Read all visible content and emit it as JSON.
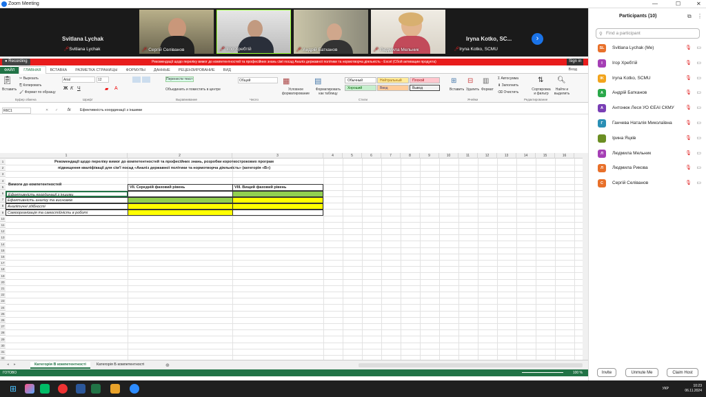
{
  "window": {
    "title": "Zoom Meeting"
  },
  "gallery": {
    "tiles": [
      {
        "name": "Svitlana Lychak"
      },
      {
        "name": "Сергій Селіванов"
      },
      {
        "name": "Ігор Хребтій"
      },
      {
        "name": "Андрій Батканов"
      },
      {
        "name": "Людмила Мельник"
      },
      {
        "name": "Iryna Kotko, SCMU"
      }
    ],
    "big_names": [
      "Svitlana Lychak",
      "Iryna Kotko, SC..."
    ]
  },
  "recording": {
    "label": "Recording"
  },
  "signin": {
    "label": "Sign in"
  },
  "excel": {
    "title_bar": "Рекомендації щодо переліку вимог до компетентностей та професійних знань сімї посад Аналіз державної політики та нормотворча діяльність - Excel (Сбой активации продукта)",
    "tabs": [
      "ФАЙЛ",
      "ГЛАВНАЯ",
      "ВСТАВКА",
      "РАЗМЕТКА СТРАНИЦЫ",
      "ФОРМУЛЫ",
      "ДАННЫЕ",
      "РЕЦЕНЗИРОВАНИЕ",
      "ВИД"
    ],
    "login": "Вход",
    "ribbon": {
      "paste": "Вставить",
      "cut": "Вырезать",
      "copy": "Копировать",
      "format_painter": "Формат по образцу",
      "font": "Arial",
      "size": "12",
      "wrap": "Перенести текст",
      "merge": "Объединить и поместить в центре",
      "number_format": "Общий",
      "cond_format": "Условное форматирование",
      "format_table": "Форматировать как таблицу",
      "styles": [
        "Обычный",
        "Нейтральный",
        "Плохой",
        "Хороший",
        "Ввод",
        "Вывод"
      ],
      "insert": "Вставить",
      "delete": "Удалить",
      "format": "Формат",
      "autosum": "Автосумма",
      "fill": "Заполнить",
      "clear": "Очистить",
      "sort": "Сортировка и фильтр",
      "find": "Найти и выделить",
      "groups": [
        "Буфер обмена",
        "Шрифт",
        "Выравнивание",
        "Число",
        "Стили",
        "Ячейки",
        "Редактирование"
      ]
    },
    "namebox": "R6C1",
    "fx": "fx",
    "formula": "Ефективність координації з іншими",
    "col_headers": [
      "1",
      "2",
      "3",
      "4",
      "5",
      "6",
      "7",
      "8",
      "9",
      "10",
      "11",
      "12",
      "13",
      "14",
      "15",
      "16"
    ],
    "row_headers": [
      "1",
      "2",
      "3",
      "4",
      "5",
      "6",
      "7",
      "8",
      "9",
      "10",
      "11",
      "12",
      "13",
      "14",
      "15",
      "16",
      "17",
      "18",
      "19",
      "20",
      "21",
      "22",
      "23",
      "24",
      "25",
      "26",
      "27",
      "28",
      "29",
      "30",
      "31",
      "32",
      "33",
      "34",
      "35",
      "36"
    ],
    "cells": {
      "title1": "Рекомендації щодо переліку вимог до компетентностей та професійних знань, розробки короткострокових програм",
      "title2": "підвищення кваліфікації для сім'ї посад «Аналіз державної політики та нормотворча діяльність» (категорія «В»)",
      "req": "Вимоги до компетентностей",
      "lvl7": "VII. Середній фаховий рівень",
      "lvl8": "VIII. Вищий фаховий рівень",
      "r6": "Ефективність координації з іншими",
      "r7": "Ефективність аналізу та висновків",
      "r8": "Аналітичні здібності",
      "r9": "Самоорганізація та самостійність в роботі"
    },
    "sheet_tabs": [
      "Категорія В компетентності",
      "Категорія Б компетентності"
    ],
    "status": "ГОТОВО",
    "zoom": "100 %"
  },
  "participants": {
    "title": "Participants (10)",
    "search_placeholder": "Find a participant",
    "list": [
      {
        "initials": "SL",
        "name": "Svitlana Lychak (Me)",
        "color": "#e8702a"
      },
      {
        "initials": "І",
        "name": "Ігор Хребтій",
        "color": "#a53fb5"
      },
      {
        "initials": "IK",
        "name": "Iryna Kotko, SCMU",
        "color": "#f2a41c"
      },
      {
        "initials": "А",
        "name": "Андрій Батканов",
        "color": "#2aa84a"
      },
      {
        "initials": "А",
        "name": "Антонюк Леся УО ЄЕАІ СКМУ",
        "color": "#7a3fb5"
      },
      {
        "initials": "Г",
        "name": "Ганчева Наталія Миколаївна",
        "color": "#2a8fb5"
      },
      {
        "initials": "",
        "name": "Ірина Яцків",
        "color": "#6b8e23"
      },
      {
        "initials": "Л",
        "name": "Людмила Мельник",
        "color": "#a53fb5"
      },
      {
        "initials": "Л",
        "name": "Людмила Рикова",
        "color": "#e8702a"
      },
      {
        "initials": "С",
        "name": "Сергій Селіванов",
        "color": "#e8702a"
      }
    ],
    "buttons": {
      "invite": "Invite",
      "unmute": "Unmute Me",
      "claim": "Claim Host"
    }
  },
  "taskbar": {
    "lang": "УКР",
    "time": "10:23",
    "date": "06.11.2024"
  }
}
